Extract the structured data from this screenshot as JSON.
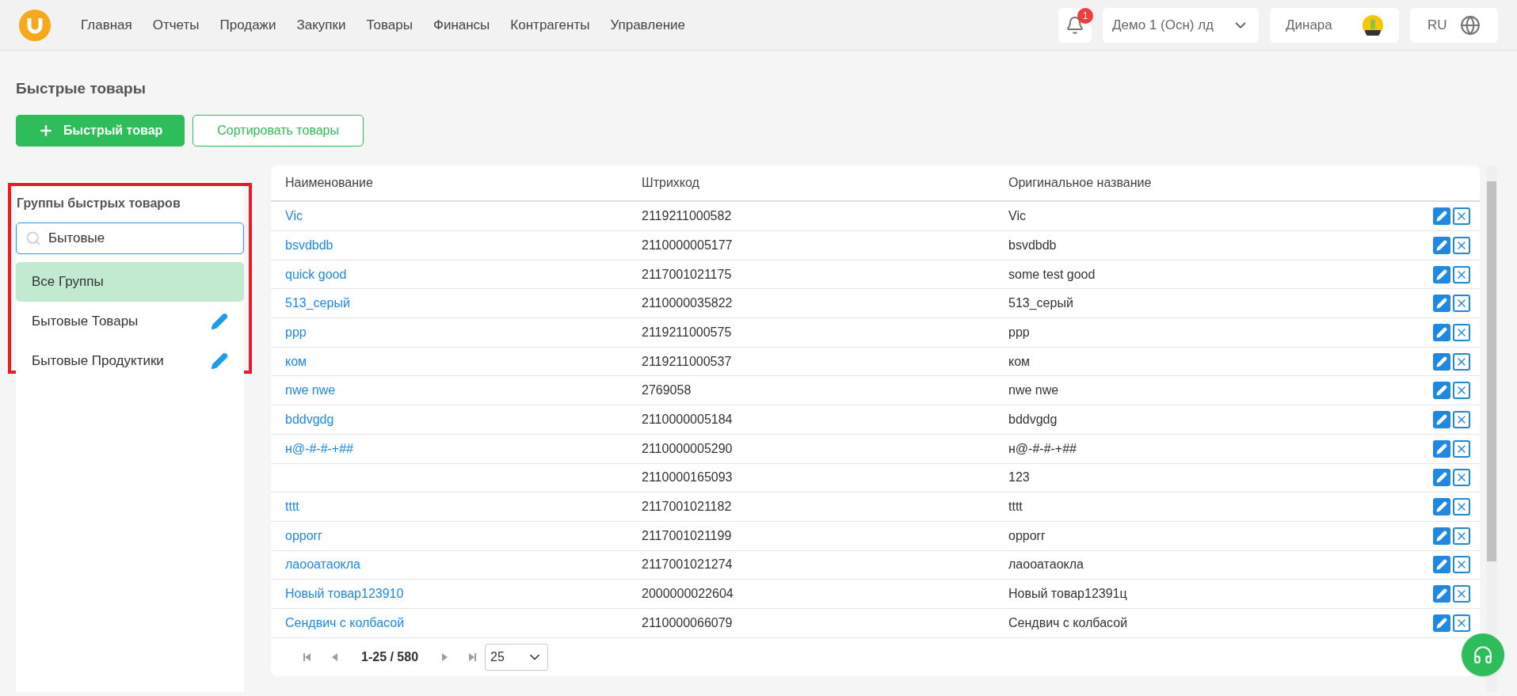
{
  "nav": {
    "items": [
      "Главная",
      "Отчеты",
      "Продажи",
      "Закупки",
      "Товары",
      "Финансы",
      "Контрагенты",
      "Управление"
    ],
    "notifications": "1",
    "company": "Демо 1 (Осн) лд",
    "user": "Динара",
    "language": "RU"
  },
  "page": {
    "title": "Быстрые товары",
    "buttons": [
      {
        "label": "Быстрый товар",
        "kind": "primary"
      },
      {
        "label": "Сортировать товары",
        "kind": "outline"
      }
    ]
  },
  "groups": {
    "title": "Группы быстрых товаров",
    "highlighted": true,
    "search": {
      "value": "Бытовые"
    },
    "items": [
      {
        "name": "Все Группы",
        "selected": true,
        "editable": false
      },
      {
        "name": "Бытовые Товары",
        "selected": false,
        "editable": true
      },
      {
        "name": "Бытовые Продуктики",
        "selected": false,
        "editable": true
      }
    ]
  },
  "table": {
    "columns": [
      "Наименование",
      "Штрихкод",
      "Оригинальное название"
    ],
    "rows": [
      {
        "name": "Vic",
        "barcode": "2119211000582",
        "original": "Vic"
      },
      {
        "name": "bsvdbdb",
        "barcode": "2110000005177",
        "original": "bsvdbdb"
      },
      {
        "name": "quick good",
        "barcode": "2117001021175",
        "original": "some test good"
      },
      {
        "name": "513_серый",
        "barcode": "2110000035822",
        "original": "513_серый"
      },
      {
        "name": "ppp",
        "barcode": "2119211000575",
        "original": "ppp"
      },
      {
        "name": "ком",
        "barcode": "2119211000537",
        "original": "ком"
      },
      {
        "name": "nwe nwe",
        "barcode": "2769058",
        "original": "nwe nwe"
      },
      {
        "name": "bddvgdg",
        "barcode": "2110000005184",
        "original": "bddvgdg"
      },
      {
        "name": "н@-#-#-+##",
        "barcode": "2110000005290",
        "original": "н@-#-#-+##"
      },
      {
        "barcode": "2110000165093",
        "original": "123"
      },
      {
        "name": "tttt",
        "barcode": "2117001021182",
        "original": "tttt"
      },
      {
        "name": "opporг",
        "barcode": "2117001021199",
        "original": "opporг"
      },
      {
        "name": "лаооатаокла",
        "barcode": "2117001021274",
        "original": "лаооатаокла"
      },
      {
        "name": "Новый товар123910",
        "barcode": "2000000022604",
        "original": "Новый товар12391ц"
      },
      {
        "name": "Сендвич с колбасой",
        "barcode": "2110000066079",
        "original": "Сендвич с колбасой"
      }
    ],
    "pagination": {
      "range": "1-25 / 580",
      "page_size": "25"
    }
  }
}
